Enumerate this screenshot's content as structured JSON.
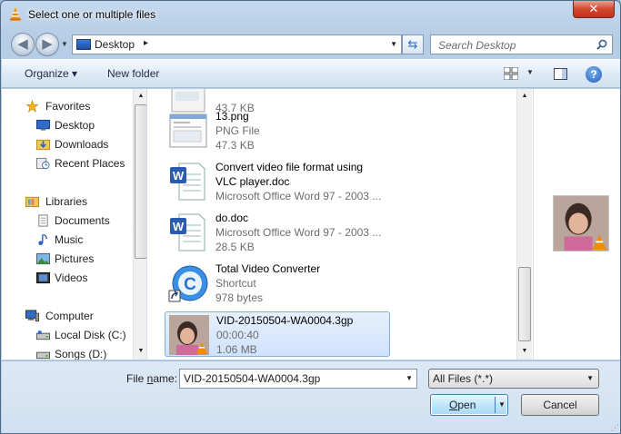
{
  "window": {
    "title": "Select one or multiple files",
    "close_glyph": "✕"
  },
  "nav": {
    "back_glyph": "◀",
    "forward_glyph": "▶",
    "address": "Desktop",
    "address_separator": "▸",
    "search_placeholder": "Search Desktop"
  },
  "toolbar": {
    "organize": "Organize ▾",
    "new_folder": "New folder",
    "help": "?"
  },
  "sidebar": {
    "favorites": "Favorites",
    "desktop": "Desktop",
    "downloads": "Downloads",
    "recent": "Recent Places",
    "libraries": "Libraries",
    "documents": "Documents",
    "music": "Music",
    "pictures": "Pictures",
    "videos": "Videos",
    "computer": "Computer",
    "local_disk": "Local Disk (C:)",
    "songs": "Songs (D:)"
  },
  "files": [
    {
      "name": "",
      "type": "",
      "size": "43.7 KB",
      "icon": "image-thumbnail-icon"
    },
    {
      "name": "13.png",
      "type": "PNG File",
      "size": "47.3 KB",
      "icon": "png-thumbnail-icon"
    },
    {
      "name": "Convert video file format using",
      "name2": "VLC player.doc",
      "type": "Microsoft Office Word 97 - 2003 ...",
      "size": "",
      "icon": "word-document-icon"
    },
    {
      "name": "do.doc",
      "type": "Microsoft Office Word 97 - 2003 ...",
      "size": "28.5 KB",
      "icon": "word-document-icon"
    },
    {
      "name": "Total Video Converter",
      "type": "Shortcut",
      "size": "978 bytes",
      "icon": "video-converter-shortcut-icon"
    },
    {
      "name": "VID-20150504-WA0004.3gp",
      "type": "00:00:40",
      "size": "1.06 MB",
      "icon": "video-thumbnail-icon"
    }
  ],
  "bottom": {
    "file_name_label_pre": "File ",
    "file_name_label_n": "n",
    "file_name_label_post": "ame:",
    "file_name_value": "VID-20150504-WA0004.3gp",
    "filter_value": "All Files (*.*)",
    "open_label_o": "O",
    "open_label_rest": "pen",
    "cancel_label": "Cancel"
  },
  "colors": {
    "selection": "#cfe2fb",
    "accent": "#3c7fb1",
    "vlc_orange": "#f28b00"
  }
}
